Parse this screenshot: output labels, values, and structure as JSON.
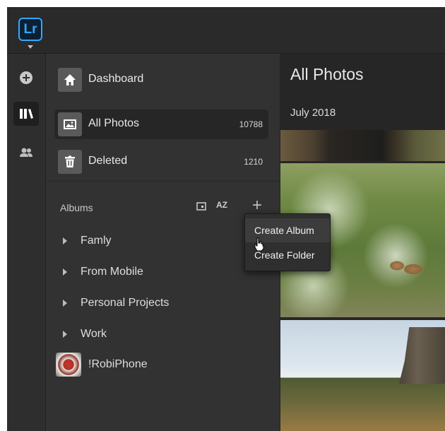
{
  "app": {
    "logo_text": "Lr",
    "accent": "#31a8ff"
  },
  "rail": {
    "icons": [
      "add-photos-icon",
      "library-icon",
      "people-icon"
    ],
    "active": "library-icon"
  },
  "sidebar": {
    "nav": [
      {
        "label": "Dashboard",
        "count": "",
        "icon": "home-icon"
      },
      {
        "label": "All Photos",
        "count": "10788",
        "icon": "photos-icon",
        "selected": true
      },
      {
        "label": "Deleted",
        "count": "1210",
        "icon": "trash-icon"
      }
    ],
    "albums_header": "Albums",
    "sort_az_label": "AZ",
    "add_label": "+",
    "albums": [
      {
        "label": "Famly"
      },
      {
        "label": "From Mobile"
      },
      {
        "label": "Personal Projects"
      },
      {
        "label": "Work"
      }
    ],
    "album_with_thumb": {
      "label": "!RobiPhone"
    }
  },
  "content": {
    "title": "All Photos",
    "date_group": "July 2018"
  },
  "popup_menu": {
    "items": [
      "Create Album",
      "Create Folder"
    ],
    "hovered": "Create Album"
  }
}
